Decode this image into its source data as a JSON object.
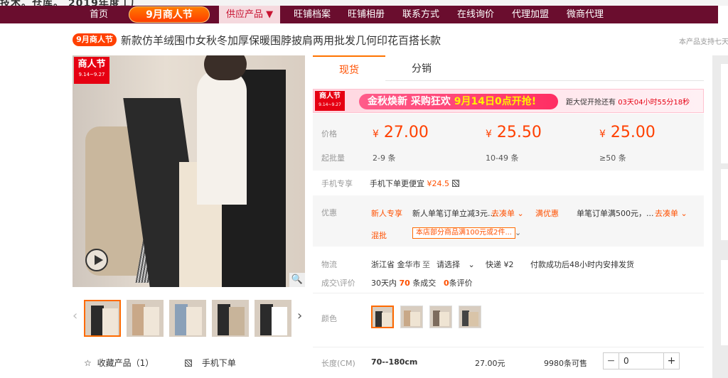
{
  "top": {
    "truncated_text": "技术。仓库。 2019年度工厂"
  },
  "nav": {
    "items": [
      "首页",
      "供应产品 ▼",
      "旺铺档案",
      "旺铺相册",
      "联系方式",
      "在线询价",
      "代理加盟",
      "微商代理"
    ],
    "badge": "9月商人节"
  },
  "product": {
    "title_badge": "9月商人节",
    "title": "新款仿羊绒围巾女秋冬加厚保暖围脖披肩两用批发几何印花百搭长款",
    "right_note": "本产品支持七天"
  },
  "image": {
    "badge_title": "商人节",
    "badge_date": "9.14~9.27",
    "zoom_icon": "🔍"
  },
  "thumbs": {
    "prev": "‹",
    "next": "›"
  },
  "actions": {
    "favorite": "收藏产品（1）",
    "mobile_order": "手机下单"
  },
  "tabs": {
    "spot": "现货",
    "distribution": "分销"
  },
  "banner": {
    "badge_title": "商人节",
    "badge_date": "9.14~9.27",
    "slogan_a": "金秋焕新 采购狂欢 ",
    "slogan_b": "9月14日0点开抢!",
    "countdown_a": "距大促开抢还有 ",
    "countdown_b": "03天04小时55分18秒"
  },
  "pricing": {
    "price_label": "价格",
    "moq_label": "起批量",
    "tiers": [
      {
        "price": "27.00",
        "qty": "2-9 条"
      },
      {
        "price": "25.50",
        "qty": "10-49 条"
      },
      {
        "price": "25.00",
        "qty": "≥50 条"
      }
    ],
    "currency": "¥",
    "mobile_label": "手机专享",
    "mobile_text": "手机下单更便宜",
    "mobile_price": "¥24.5"
  },
  "promo": {
    "label": "优惠",
    "new_user_tag": "新人专享",
    "new_user_text": "新人单笔订单立减3元...",
    "new_user_link": "去凑单 ⌄",
    "full_tag": "满优惠",
    "full_text": "单笔订单满500元，...",
    "full_link": "去凑单 ⌄",
    "mix_tag": "混批",
    "mix_text": "本店部分商品满100元或2件...",
    "mix_chevron": "⌄"
  },
  "logistics": {
    "label": "物流",
    "origin": "浙江省 金华市",
    "to": "至",
    "dest": "请选择",
    "dest_chevron": "⌄",
    "express": "快递 ¥2",
    "note": "付款成功后48小时内安排发货"
  },
  "deals": {
    "label": "成交\\评价",
    "prefix": "30天内",
    "count": "70",
    "suffix": "条成交",
    "reviews": "0",
    "reviews_suffix": "条评价"
  },
  "color": {
    "label": "颜色",
    "count": 4
  },
  "sku": {
    "label": "长度(CM)",
    "size": "70--180cm",
    "price": "27.00元",
    "stock": "9980条可售",
    "quantity": "0",
    "minus": "−",
    "plus": "+"
  }
}
